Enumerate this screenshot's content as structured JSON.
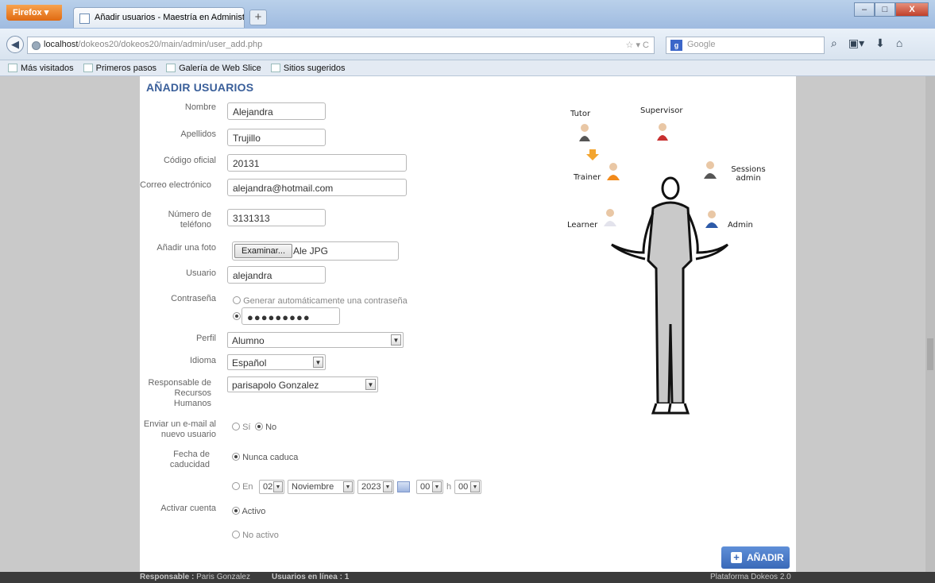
{
  "browser": {
    "app_button": "Firefox",
    "tab_title": "Añadir usuarios - Maestría en Administr...",
    "new_tab": "+",
    "url_host": "localhost",
    "url_path": "/dokeos20/dokeos20/main/admin/user_add.php",
    "search_placeholder": "Google",
    "win_min": "–",
    "win_max": "□",
    "win_close": "X"
  },
  "bookmarks": [
    "Más visitados",
    "Primeros pasos",
    "Galería de Web Slice",
    "Sitios sugeridos"
  ],
  "form": {
    "heading": "AÑADIR USUARIOS",
    "labels": {
      "nombre": "Nombre",
      "apellidos": "Apellidos",
      "codigo": "Código oficial",
      "correo": "Correo electrónico",
      "telefono": "Número de teléfono",
      "foto": "Añadir una foto",
      "usuario": "Usuario",
      "contrasena": "Contraseña",
      "perfil": "Perfil",
      "idioma": "Idioma",
      "responsable": "Responsable de Recursos Humanos",
      "enviar": "Enviar un e-mail al nuevo usuario",
      "fecha": "Fecha de caducidad",
      "activar": "Activar cuenta"
    },
    "values": {
      "nombre": "Alejandra",
      "apellidos": "Trujillo",
      "codigo": "20131",
      "correo": "alejandra@hotmail.com",
      "telefono": "3131313",
      "browse_button": "Examinar...",
      "file_name": "Ale JPG",
      "usuario": "alejandra",
      "gen_password": "Generar automáticamente una contraseña",
      "password_mask": "●●●●●●●●●",
      "perfil": "Alumno",
      "idioma": "Español",
      "responsable": "parisapolo Gonzalez",
      "si": "Sí",
      "no": "No",
      "nunca": "Nunca caduca",
      "en": "En",
      "day": "02",
      "month": "Noviembre",
      "year": "2023",
      "hour": "00",
      "h": "h",
      "minute": "00",
      "activo": "Activo",
      "no_activo": "No activo"
    },
    "submit": "AÑADIR"
  },
  "roles": [
    "Tutor",
    "Supervisor",
    "Trainer",
    "Sessions admin",
    "Learner",
    "Admin"
  ],
  "footer": {
    "responsable_label": "Responsable :",
    "responsable_value": "Paris Gonzalez",
    "online": "Usuarios en línea : 1",
    "platform": "Plataforma Dokeos 2.0"
  }
}
